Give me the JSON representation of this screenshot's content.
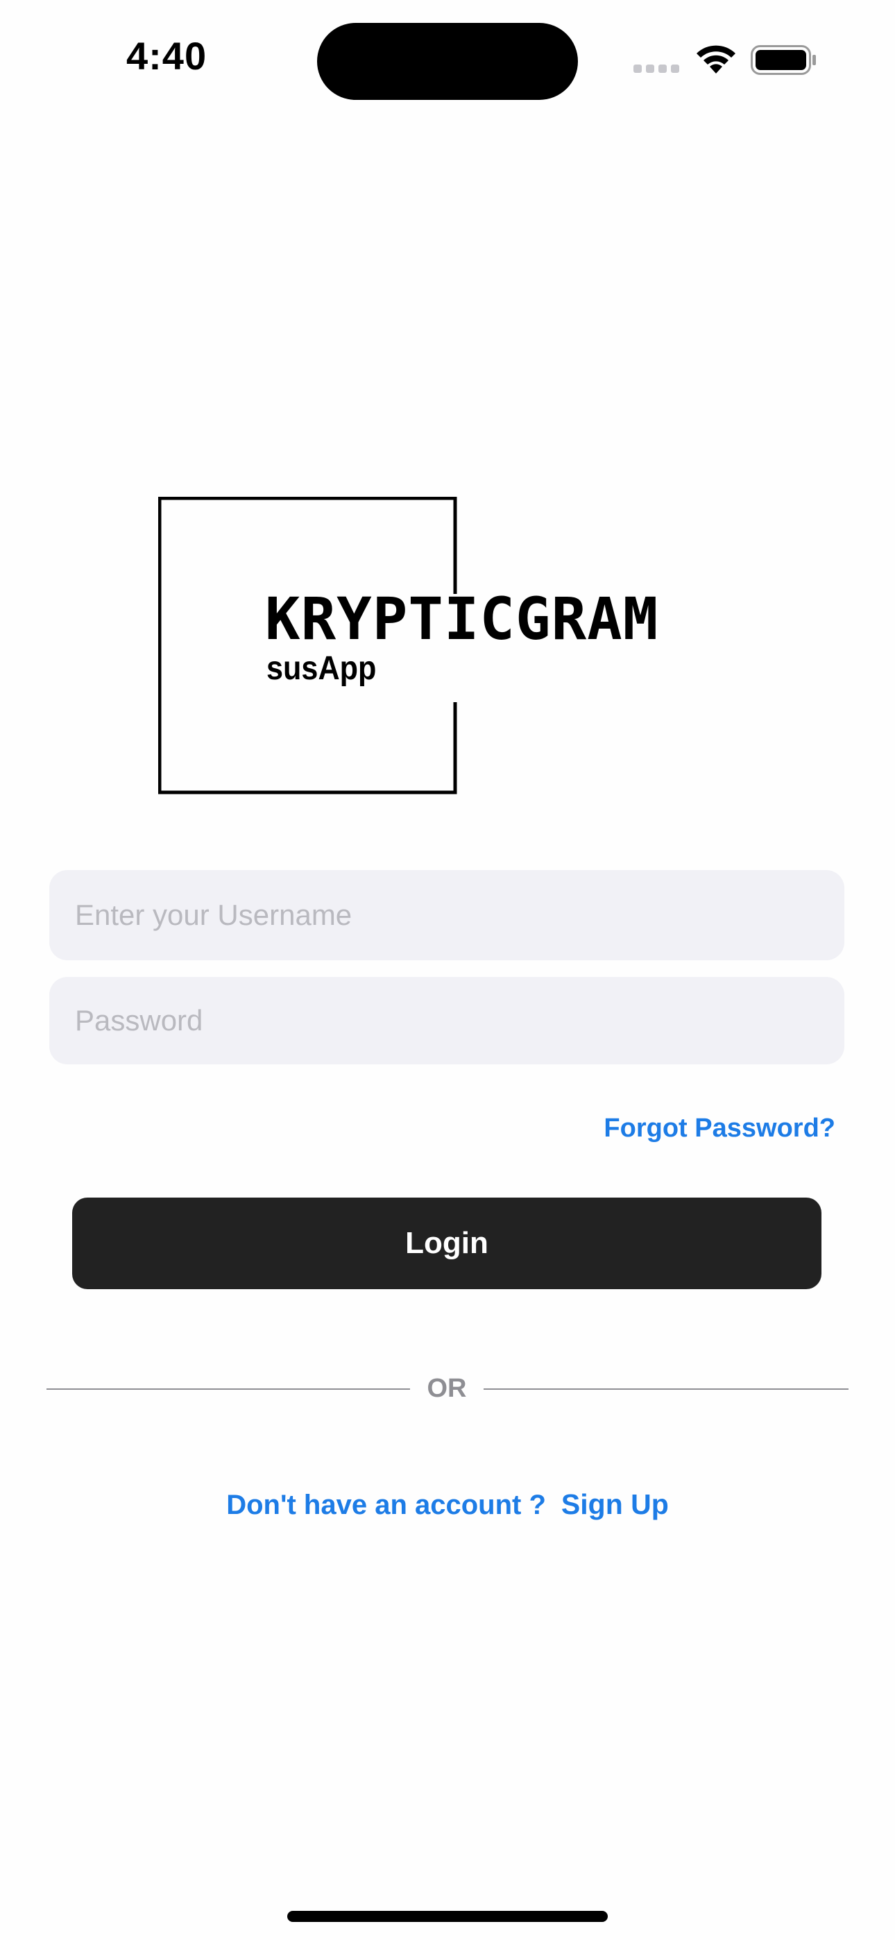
{
  "status_bar": {
    "time": "4:40"
  },
  "logo": {
    "title": "KRYPTICGRAM",
    "subtitle": "susApp"
  },
  "form": {
    "username_placeholder": "Enter your Username",
    "username_value": "",
    "password_placeholder": "Password",
    "password_value": "",
    "forgot_password_label": "Forgot Password?",
    "login_label": "Login"
  },
  "divider": {
    "label": "OR"
  },
  "signup": {
    "prompt": "Don't have an account ?",
    "link_label": "Sign Up"
  },
  "colors": {
    "accent": "#1d7ce6",
    "button_bg": "#222222",
    "field_bg": "#f1f1f6",
    "divider": "#8e8e93"
  },
  "icons": {
    "signal": "cellular-signal-icon",
    "wifi": "wifi-icon",
    "battery": "battery-icon"
  }
}
